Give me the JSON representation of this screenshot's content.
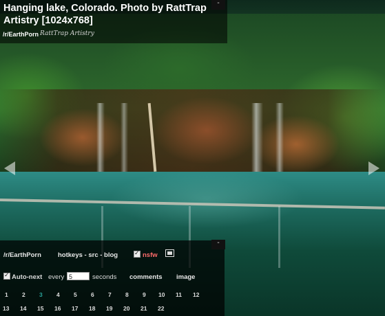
{
  "title": "Hanging lake, Colorado. Photo by RattTrap Artistry [1024x768]",
  "subreddit_label": "/r/EarthPorn",
  "signature": "RattTrap Artistry",
  "collapse_symbol": "-",
  "nav": {
    "left_arrow_icon": "arrow-left-icon",
    "right_arrow_icon": "arrow-right-icon"
  },
  "panel": {
    "subreddit_link": "/r/EarthPorn",
    "hotkeys_link": "hotkeys - src - blog",
    "nsfw_label": "nsfw",
    "nsfw_checked": true,
    "fullscreen_icon": "fullscreen-icon",
    "autonext_label": "Auto-next",
    "autonext_checked": true,
    "every_label": "every",
    "every_value": "5",
    "seconds_label": "seconds",
    "comments_link": "comments",
    "image_link": "image",
    "numbers_row1": [
      "1",
      "2",
      "3",
      "4",
      "5",
      "6",
      "7",
      "8",
      "9",
      "10",
      "11",
      "12"
    ],
    "numbers_row2": [
      "13",
      "14",
      "15",
      "16",
      "17",
      "18",
      "19",
      "20",
      "21",
      "22"
    ],
    "active_number": "3"
  },
  "colors": {
    "active_number": "#2aa39a",
    "nsfw": "#ff6b6b"
  }
}
